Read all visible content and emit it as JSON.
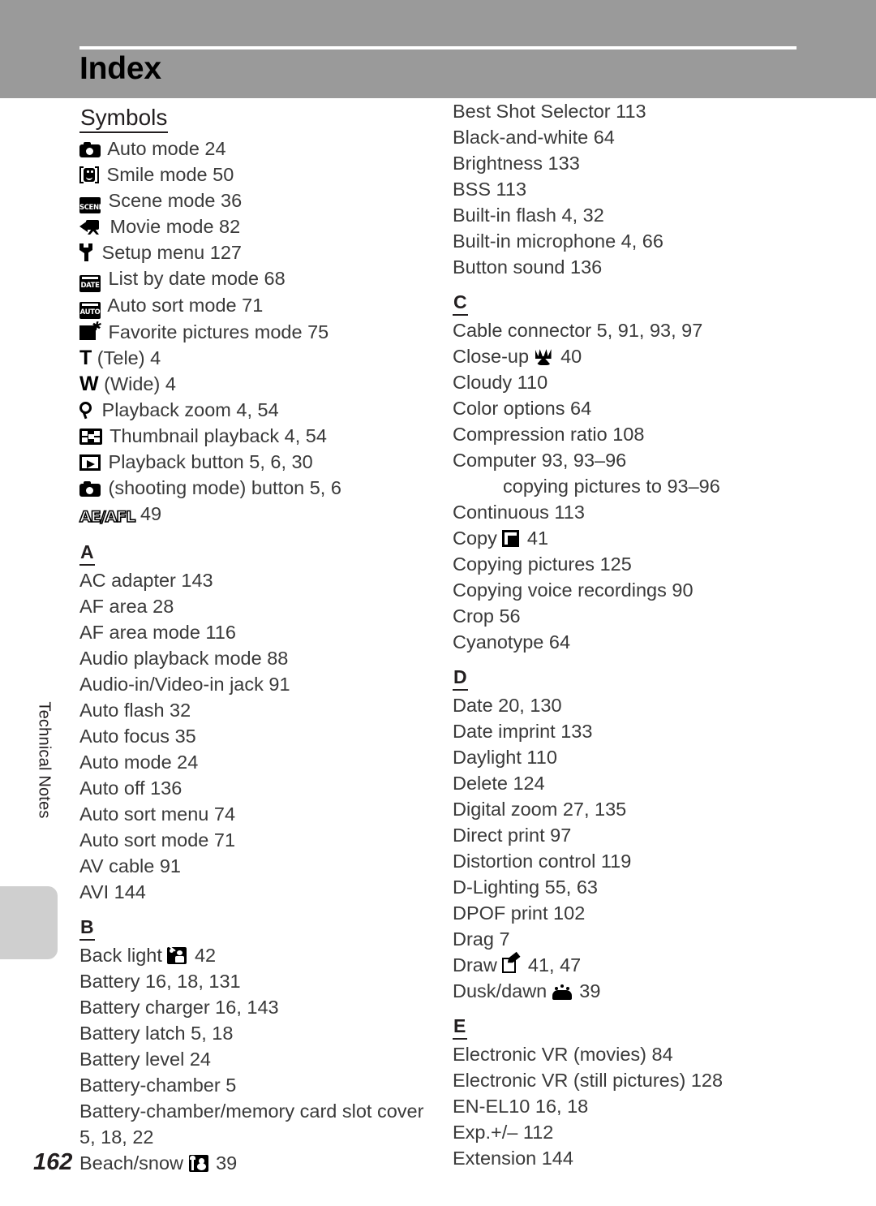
{
  "header": {
    "title": "Index"
  },
  "side_tab": {
    "label": "Technical Notes"
  },
  "page_number": "162",
  "columns": {
    "left": [
      {
        "type": "section",
        "label": "Symbols",
        "style": "symbols"
      },
      {
        "type": "entry",
        "icon": "camera-icon",
        "text": "Auto mode 24"
      },
      {
        "type": "entry",
        "icon": "smile-mode-icon",
        "text": "Smile mode 50"
      },
      {
        "type": "entry",
        "icon": "scene-mode-icon",
        "icon_label": "SCENE",
        "text": "Scene mode 36"
      },
      {
        "type": "entry",
        "icon": "movie-camera-icon",
        "text": "Movie mode 82"
      },
      {
        "type": "entry",
        "icon": "wrench-icon",
        "text": "Setup menu 127"
      },
      {
        "type": "entry",
        "icon": "date-box-icon",
        "icon_label": "DATE",
        "text": "List by date mode 68"
      },
      {
        "type": "entry",
        "icon": "auto-box-icon",
        "icon_label": "AUTO",
        "text": "Auto sort mode 71"
      },
      {
        "type": "entry",
        "icon": "favorite-pictures-icon",
        "text": "Favorite pictures mode 75"
      },
      {
        "type": "entry",
        "icon": "tele-letter-icon",
        "icon_glyph": "T",
        "text": "(Tele) 4"
      },
      {
        "type": "entry",
        "icon": "wide-letter-icon",
        "icon_glyph": "W",
        "text": "(Wide) 4"
      },
      {
        "type": "entry",
        "icon": "magnifier-icon",
        "text": "Playback zoom 4, 54"
      },
      {
        "type": "entry",
        "icon": "thumbnail-grid-icon",
        "text": "Thumbnail playback 4, 54"
      },
      {
        "type": "entry",
        "icon": "playback-button-icon",
        "text": "Playback button 5, 6, 30"
      },
      {
        "type": "entry",
        "icon": "camera-icon",
        "text": "(shooting mode) button 5, 6"
      },
      {
        "type": "entry",
        "icon": "ae-afl-icon",
        "icon_label": "AE/AFL",
        "text": "49"
      },
      {
        "type": "section",
        "label": "A",
        "style": "alpha"
      },
      {
        "type": "entry",
        "text": "AC adapter 143"
      },
      {
        "type": "entry",
        "text": "AF area 28"
      },
      {
        "type": "entry",
        "text": "AF area mode 116"
      },
      {
        "type": "entry",
        "text": "Audio playback mode 88"
      },
      {
        "type": "entry",
        "text": "Audio-in/Video-in jack 91"
      },
      {
        "type": "entry",
        "text": "Auto flash 32"
      },
      {
        "type": "entry",
        "text": "Auto focus 35"
      },
      {
        "type": "entry",
        "text": "Auto mode 24"
      },
      {
        "type": "entry",
        "text": "Auto off 136"
      },
      {
        "type": "entry",
        "text": "Auto sort menu 74"
      },
      {
        "type": "entry",
        "text": "Auto sort mode 71"
      },
      {
        "type": "entry",
        "text": "AV cable 91"
      },
      {
        "type": "entry",
        "text": "AVI 144"
      },
      {
        "type": "section",
        "label": "B",
        "style": "alpha"
      },
      {
        "type": "entry",
        "text_before": "Back light",
        "icon": "back-light-icon",
        "text_after": "42"
      },
      {
        "type": "entry",
        "text": "Battery 16, 18, 131"
      },
      {
        "type": "entry",
        "text": "Battery charger 16, 143"
      },
      {
        "type": "entry",
        "text": "Battery latch 5, 18"
      },
      {
        "type": "entry",
        "text": "Battery level 24"
      },
      {
        "type": "entry",
        "text": "Battery-chamber 5"
      },
      {
        "type": "entry",
        "wrap": true,
        "text": "Battery-chamber/memory card slot cover 5, 18, 22"
      },
      {
        "type": "entry",
        "text_before": "Beach/snow",
        "icon": "beach-snow-icon",
        "text_after": "39"
      }
    ],
    "right": [
      {
        "type": "entry",
        "text": "Best Shot Selector 113"
      },
      {
        "type": "entry",
        "text": "Black-and-white 64"
      },
      {
        "type": "entry",
        "text": "Brightness 133"
      },
      {
        "type": "entry",
        "text": "BSS 113"
      },
      {
        "type": "entry",
        "text": "Built-in flash 4, 32"
      },
      {
        "type": "entry",
        "text": "Built-in microphone 4, 66"
      },
      {
        "type": "entry",
        "text": "Button sound 136"
      },
      {
        "type": "section",
        "label": "C",
        "style": "alpha"
      },
      {
        "type": "entry",
        "text": "Cable connector 5, 91, 93, 97"
      },
      {
        "type": "entry",
        "text_before": "Close-up",
        "icon": "close-up-tulip-icon",
        "text_after": "40"
      },
      {
        "type": "entry",
        "text": "Cloudy 110"
      },
      {
        "type": "entry",
        "text": "Color options 64"
      },
      {
        "type": "entry",
        "text": "Compression ratio 108"
      },
      {
        "type": "entry",
        "text": "Computer 93, 93–96"
      },
      {
        "type": "entry",
        "indent": true,
        "text": "copying pictures to 93–96"
      },
      {
        "type": "entry",
        "text": "Continuous 113"
      },
      {
        "type": "entry",
        "text_before": "Copy",
        "icon": "copy-icon",
        "text_after": "41"
      },
      {
        "type": "entry",
        "text": "Copying pictures 125"
      },
      {
        "type": "entry",
        "text": "Copying voice recordings 90"
      },
      {
        "type": "entry",
        "text": "Crop 56"
      },
      {
        "type": "entry",
        "text": "Cyanotype 64"
      },
      {
        "type": "section",
        "label": "D",
        "style": "alpha"
      },
      {
        "type": "entry",
        "text": "Date 20, 130"
      },
      {
        "type": "entry",
        "text": "Date imprint 133"
      },
      {
        "type": "entry",
        "text": "Daylight 110"
      },
      {
        "type": "entry",
        "text": "Delete 124"
      },
      {
        "type": "entry",
        "text": "Digital zoom 27, 135"
      },
      {
        "type": "entry",
        "text": "Direct print 97"
      },
      {
        "type": "entry",
        "text": "Distortion control 119"
      },
      {
        "type": "entry",
        "text": "D-Lighting 55, 63"
      },
      {
        "type": "entry",
        "text": "DPOF print 102"
      },
      {
        "type": "entry",
        "text": "Drag 7"
      },
      {
        "type": "entry",
        "text_before": "Draw",
        "icon": "draw-icon",
        "text_after": "41, 47"
      },
      {
        "type": "entry",
        "text_before": "Dusk/dawn",
        "icon": "dusk-dawn-icon",
        "text_after": "39"
      },
      {
        "type": "section",
        "label": "E",
        "style": "alpha"
      },
      {
        "type": "entry",
        "text": "Electronic VR (movies) 84"
      },
      {
        "type": "entry",
        "text": "Electronic VR (still pictures) 128"
      },
      {
        "type": "entry",
        "text": "EN-EL10 16, 18"
      },
      {
        "type": "entry",
        "text": "Exp.+/– 112"
      },
      {
        "type": "entry",
        "text": "Extension 144"
      }
    ]
  },
  "colors": {
    "header_background": "#9a9a9a",
    "header_rule": "#ffffff",
    "side_tab_block": "#cfcfcf",
    "text": "#231f20"
  }
}
